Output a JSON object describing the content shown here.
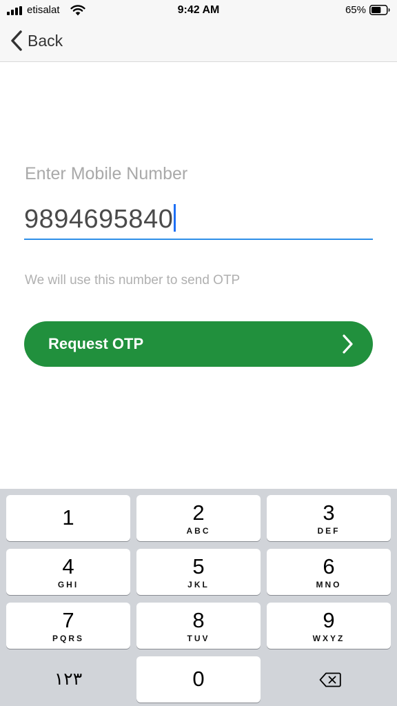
{
  "status_bar": {
    "carrier": "etisalat",
    "time": "9:42 AM",
    "battery_percent": "65%",
    "battery_level": 0.65,
    "icons": [
      "signal-icon",
      "wifi-icon",
      "battery-icon"
    ]
  },
  "nav": {
    "back_label": "Back",
    "back_icon": "chevron-left-icon"
  },
  "form": {
    "label": "Enter Mobile Number",
    "phone_value": "9894695840",
    "helper_text": "We will use this number to send OTP"
  },
  "otp_button": {
    "label": "Request OTP",
    "icon": "chevron-right-icon",
    "color": "#21903d"
  },
  "colors": {
    "accent_underline": "#2e8fe8",
    "caret": "#1e6ff5",
    "keypad_bg": "#d1d4d9"
  },
  "keypad": {
    "keys": [
      {
        "digit": "1",
        "letters": ""
      },
      {
        "digit": "2",
        "letters": "ABC"
      },
      {
        "digit": "3",
        "letters": "DEF"
      },
      {
        "digit": "4",
        "letters": "GHI"
      },
      {
        "digit": "5",
        "letters": "JKL"
      },
      {
        "digit": "6",
        "letters": "MNO"
      },
      {
        "digit": "7",
        "letters": "PQRS"
      },
      {
        "digit": "8",
        "letters": "TUV"
      },
      {
        "digit": "9",
        "letters": "WXYZ"
      },
      {
        "digit": "0",
        "letters": ""
      }
    ],
    "mode_switch_label": "١٢٣",
    "backspace_icon": "backspace-icon"
  }
}
